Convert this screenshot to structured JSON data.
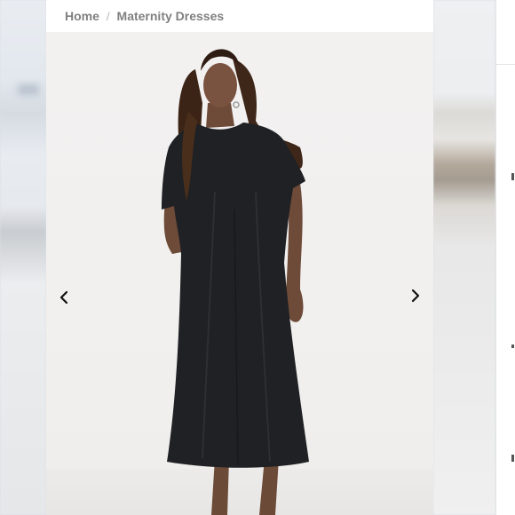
{
  "breadcrumb": {
    "home_label": "Home",
    "separator": "/",
    "current_label": "Maternity Dresses"
  },
  "gallery": {
    "prev_icon": "chevron-left-icon",
    "next_icon": "chevron-right-icon"
  },
  "colors": {
    "dress": "#1f2124",
    "background": "#f1efee",
    "breadcrumb_text": "#808080"
  }
}
